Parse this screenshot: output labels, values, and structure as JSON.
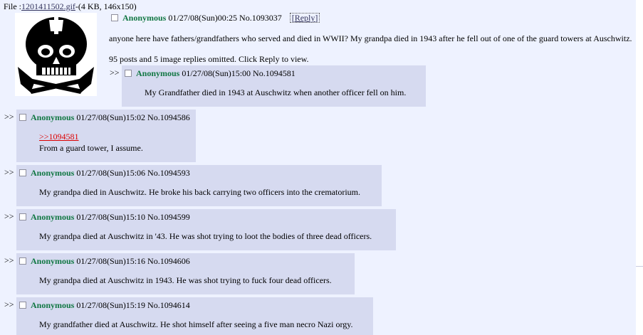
{
  "file": {
    "prefix": "File :",
    "filename": "1201411502.gif",
    "meta": "-(4 KB, 146x150)"
  },
  "op": {
    "name": "Anonymous",
    "datetime": "01/27/08(Sun)00:25",
    "postno": "No.1093037",
    "reply_label": "Reply",
    "body": "anyone here have fathers/grandfathers who served and died in WWII? My grandpa died in 1943 after he fell out of one of the guard towers at Auschwitz.",
    "omitted": "95 posts and 5 image replies omitted. Click Reply to view."
  },
  "reply_arrow": ">>",
  "replies": [
    {
      "name": "Anonymous",
      "datetime": "01/27/08(Sun)15:00",
      "postno": "No.1094581",
      "body": "My Grandfather died in 1943 at Auschwitz when another officer fell on him."
    },
    {
      "name": "Anonymous",
      "datetime": "01/27/08(Sun)15:02",
      "postno": "No.1094586",
      "quote": ">>1094581",
      "body": "From a guard tower, I assume."
    },
    {
      "name": "Anonymous",
      "datetime": "01/27/08(Sun)15:06",
      "postno": "No.1094593",
      "body": "My grandpa died in Auschwitz. He broke his back carrying two officers into the crematorium."
    },
    {
      "name": "Anonymous",
      "datetime": "01/27/08(Sun)15:10",
      "postno": "No.1094599",
      "body": "My grandpa died at Auschwitz in '43. He was shot trying to loot the bodies of three dead officers."
    },
    {
      "name": "Anonymous",
      "datetime": "01/27/08(Sun)15:16",
      "postno": "No.1094606",
      "body": "My grandpa died at Auschwitz in 1943. He was shot trying to fuck four dead officers."
    },
    {
      "name": "Anonymous",
      "datetime": "01/27/08(Sun)15:19",
      "postno": "No.1094614",
      "body": "My grandfather died at Auschwitz. He shot himself after seeing a five man necro Nazi orgy."
    }
  ],
  "colors": {
    "page_bg": "#eef2ff",
    "reply_bg": "#d6daf0",
    "name": "#117743",
    "link": "#34345c",
    "quote": "#dd0000"
  }
}
